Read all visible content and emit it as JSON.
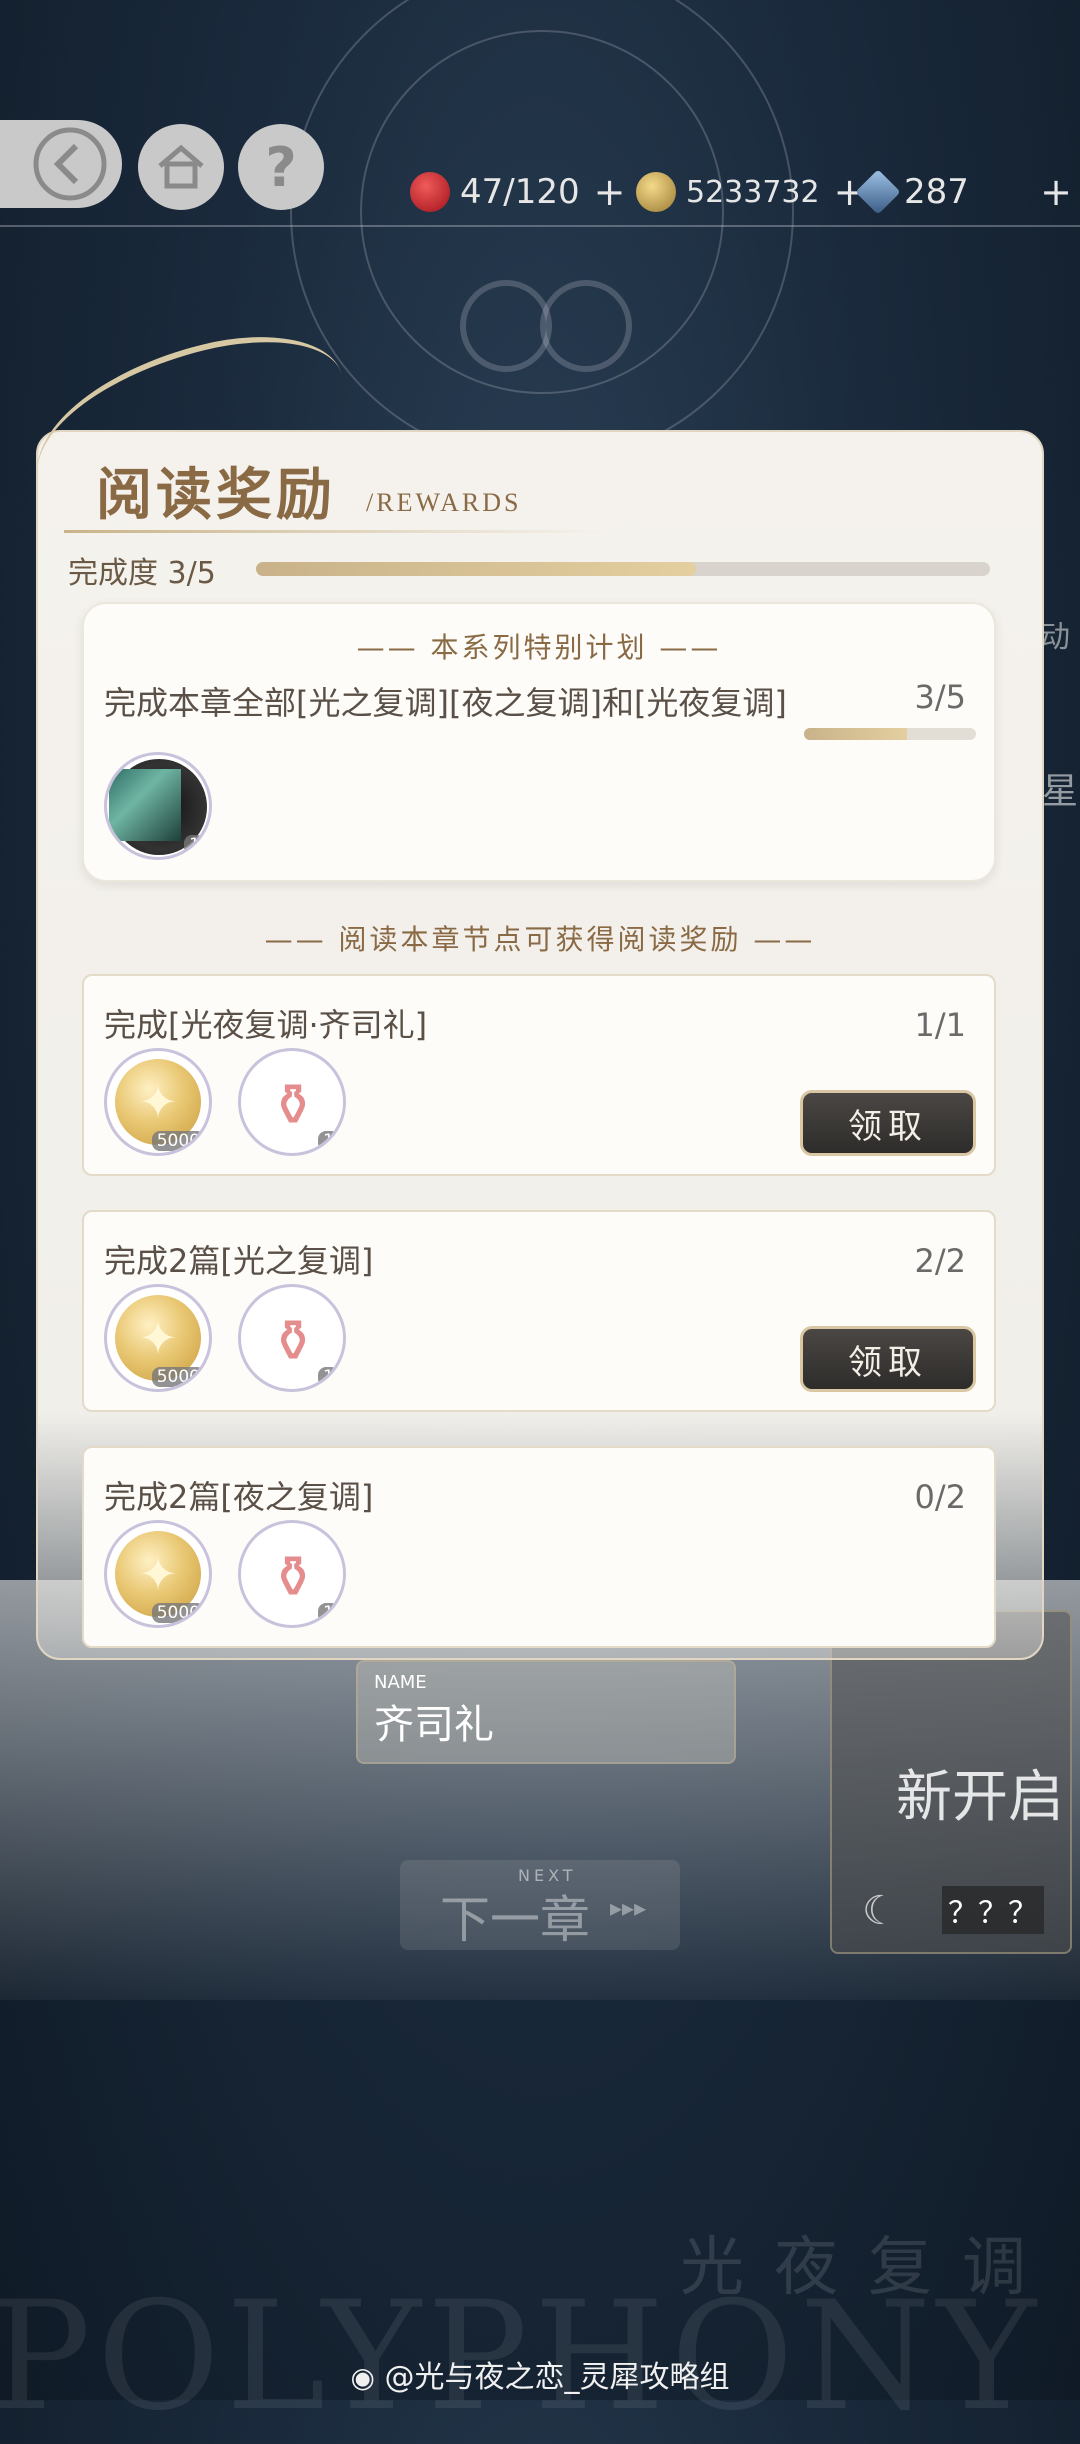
{
  "topbar": {
    "resources": [
      {
        "name": "stamina",
        "icon": "apple-icon",
        "color": "#c4202a",
        "value": "47/120"
      },
      {
        "name": "gold",
        "icon": "coin-icon",
        "color": "#c9a24a",
        "value": "5233732"
      },
      {
        "name": "diamond",
        "icon": "diamond-icon",
        "color": "#5a7fa8",
        "value": "287"
      }
    ],
    "help_label": "?",
    "plus_label": "+"
  },
  "panel": {
    "title": "阅读奖励",
    "subtitle": "/REWARDS",
    "progress_label": "完成度 3/5",
    "progress_fraction": 0.6
  },
  "special": {
    "header": "—— 本系列特别计划 ——",
    "task": "完成本章全部[光之复调][夜之复调]和[光夜复调]",
    "count": "3/5",
    "progress_fraction": 0.6,
    "reward": {
      "icon": "vinyl-record-icon",
      "qty": "1"
    }
  },
  "node_header": "—— 阅读本章节点可获得阅读奖励 ——",
  "tasks": [
    {
      "text": "完成[光夜复调·齐司礼]",
      "count": "1/1",
      "coin_qty": "5000",
      "potion_qty": "1",
      "button": "领取"
    },
    {
      "text": "完成2篇[光之复调]",
      "count": "2/2",
      "coin_qty": "5000",
      "potion_qty": "1",
      "button": "领取"
    },
    {
      "text": "完成2篇[夜之复调]",
      "count": "0/2",
      "coin_qty": "5000",
      "potion_qty": "1"
    }
  ],
  "background": {
    "name_tag": "NAME",
    "char_name": "齐司礼",
    "next_small": "NEXT",
    "next_label": "下一章",
    "new_open": "新开启",
    "unknown_name": "？？？",
    "bottom_title": "光夜复调",
    "polyphony": "POLYPHONY",
    "side_char_1": "动",
    "side_char_2": "星"
  },
  "watermark": "@光与夜之恋_灵犀攻略组"
}
